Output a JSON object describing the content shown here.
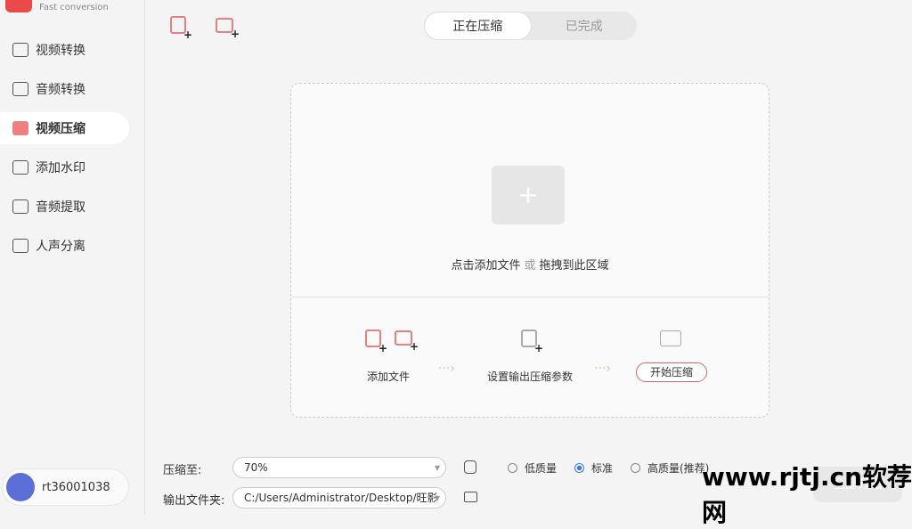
{
  "app": {
    "subtitle": "Fast conversion"
  },
  "sidebar": {
    "items": [
      {
        "label": "视频转换"
      },
      {
        "label": "音频转换"
      },
      {
        "label": "视频压缩"
      },
      {
        "label": "添加水印"
      },
      {
        "label": "音频提取"
      },
      {
        "label": "人声分离"
      }
    ],
    "user": "rt36001038"
  },
  "tabs": [
    {
      "label": "正在压缩"
    },
    {
      "label": "已完成"
    }
  ],
  "drop": {
    "hint_click": "点击添加文件",
    "hint_or": "或",
    "hint_drag": "拖拽到此区域"
  },
  "steps": {
    "add": "添加文件",
    "settings": "设置输出压缩参数",
    "start": "开始压缩"
  },
  "bottom": {
    "compress_label": "压缩至:",
    "compress_value": "70%",
    "output_label": "输出文件夹:",
    "output_value": "C:/Users/Administrator/Desktop/旺影",
    "quality": [
      {
        "label": "低质量"
      },
      {
        "label": "标准",
        "selected": true
      },
      {
        "label": "高质量(推荐)"
      }
    ],
    "start_all": "全部开始"
  },
  "watermark": "www.rjtj.cn软荐网",
  "colors": {
    "accent": "#e94b4b",
    "radio": "#3a7bf0"
  }
}
